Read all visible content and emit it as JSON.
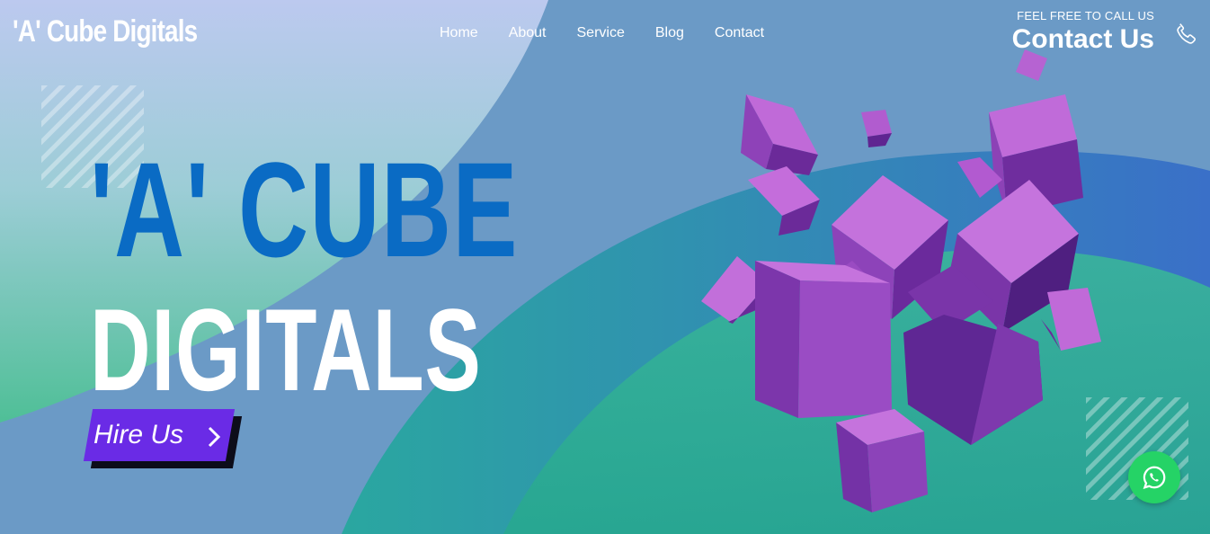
{
  "brand": {
    "logo_text": "'A' Cube Digitals"
  },
  "nav": {
    "items": [
      "Home",
      "About",
      "Service",
      "Blog",
      "Contact"
    ]
  },
  "call": {
    "tagline": "FEEL FREE TO CALL US",
    "cta": "Contact Us",
    "icon": "phone-icon"
  },
  "hero": {
    "title_line1": "'A' CUBE",
    "title_line2": "DIGITALS",
    "button_label": "Hire Us",
    "button_icon": "chevron-right-icon"
  },
  "floating": {
    "icon": "whatsapp-icon"
  },
  "colors": {
    "title_blue": "#0a6bc4",
    "button_purple": "#6a2be6",
    "whatsapp_green": "#25d366",
    "cube_purple": "#8a3fb0"
  }
}
